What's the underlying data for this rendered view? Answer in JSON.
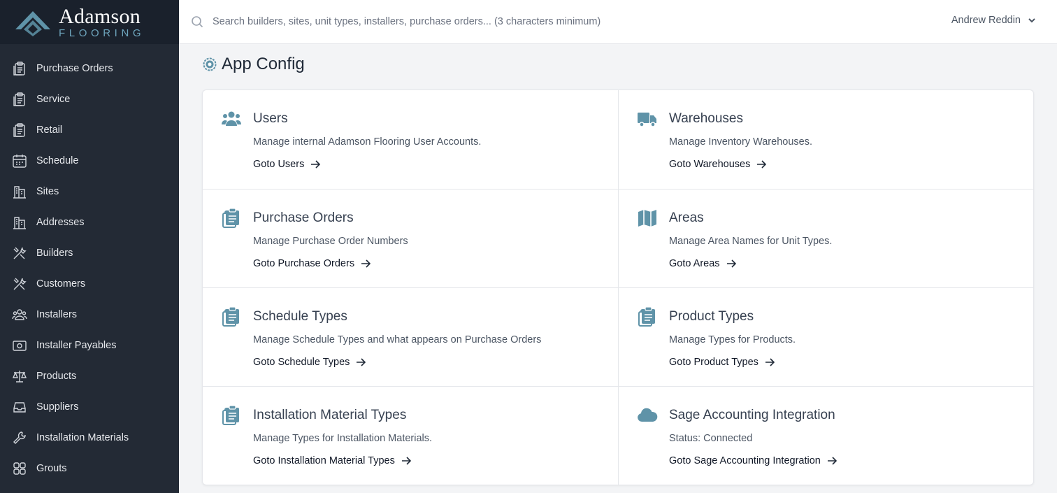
{
  "brand": {
    "name": "Adamson",
    "sub": "FLOORING"
  },
  "search": {
    "placeholder": "Search builders, sites, unit types, installers, purchase orders... (3 characters minimum)"
  },
  "user": {
    "name": "Andrew Reddin"
  },
  "sidebar": {
    "items": [
      {
        "label": "Purchase Orders",
        "icon": "clipboard-icon"
      },
      {
        "label": "Service",
        "icon": "clipboard-icon"
      },
      {
        "label": "Retail",
        "icon": "clipboard-icon"
      },
      {
        "label": "Schedule",
        "icon": "calendar-icon"
      },
      {
        "label": "Sites",
        "icon": "buildings-icon"
      },
      {
        "label": "Addresses",
        "icon": "buildings-icon"
      },
      {
        "label": "Builders",
        "icon": "tools-icon"
      },
      {
        "label": "Customers",
        "icon": "tools-icon"
      },
      {
        "label": "Installers",
        "icon": "users-icon"
      },
      {
        "label": "Installer Payables",
        "icon": "money-icon"
      },
      {
        "label": "Products",
        "icon": "scale-icon"
      },
      {
        "label": "Suppliers",
        "icon": "inbox-icon"
      },
      {
        "label": "Installation Materials",
        "icon": "wrench-icon"
      },
      {
        "label": "Grouts",
        "icon": "grid-icon"
      }
    ]
  },
  "page": {
    "title": "App Config",
    "icon": "gear-icon"
  },
  "cards": [
    {
      "title": "Users",
      "desc": "Manage internal Adamson Flooring User Accounts.",
      "link": "Goto Users",
      "icon": "users-icon"
    },
    {
      "title": "Warehouses",
      "desc": "Manage Inventory Warehouses.",
      "link": "Goto Warehouses",
      "icon": "truck-icon"
    },
    {
      "title": "Purchase Orders",
      "desc": "Manage Purchase Order Numbers",
      "link": "Goto Purchase Orders",
      "icon": "clipboard-icon"
    },
    {
      "title": "Areas",
      "desc": "Manage Area Names for Unit Types.",
      "link": "Goto Areas",
      "icon": "map-icon"
    },
    {
      "title": "Schedule Types",
      "desc": "Manage Schedule Types and what appears on Purchase Orders",
      "link": "Goto Schedule Types",
      "icon": "clipboard-icon"
    },
    {
      "title": "Product Types",
      "desc": "Manage Types for Products.",
      "link": "Goto Product Types",
      "icon": "clipboard-icon"
    },
    {
      "title": "Installation Material Types",
      "desc": "Manage Types for Installation Materials.",
      "link": "Goto Installation Material Types",
      "icon": "clipboard-icon"
    },
    {
      "title": "Sage Accounting Integration",
      "desc": "Status: Connected",
      "link": "Goto Sage Accounting Integration",
      "icon": "cloud-icon"
    }
  ],
  "colors": {
    "sidebar": "#232a35",
    "logo_bg": "#1a212c",
    "accent": "#5f93a8"
  }
}
